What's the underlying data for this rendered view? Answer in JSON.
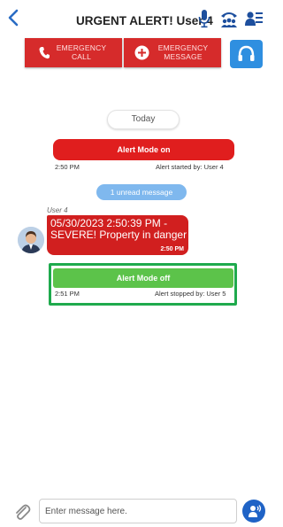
{
  "header": {
    "title": "URGENT ALERT! User 4",
    "icons": [
      "back-arrow-icon",
      "microphone-icon",
      "group-call-icon",
      "participants-icon"
    ]
  },
  "actions": {
    "emergency_call": {
      "line1": "EMERGENCY",
      "line2": "CALL",
      "icon": "phone-icon"
    },
    "emergency_message": {
      "line1": "EMERGENCY",
      "line2": "MESSAGE",
      "icon": "add-message-icon"
    },
    "headset_icon": "headset-icon"
  },
  "chat": {
    "date_divider": "Today",
    "alert_on": {
      "label": "Alert Mode on",
      "time": "2:50 PM",
      "status": "Alert started by: User 4"
    },
    "unread": "1 unread message",
    "message": {
      "sender": "User 4",
      "text": "05/30/2023 2:50:39 PM - SEVERE! Property in danger",
      "time": "2:50 PM"
    },
    "alert_off": {
      "label": "Alert Mode off",
      "time": "2:51 PM",
      "status": "Alert stopped by: User 5"
    }
  },
  "composer": {
    "placeholder": "Enter message here.",
    "attach_icon": "paperclip-icon",
    "voice_icon": "voice-assistant-icon"
  },
  "colors": {
    "alert_red": "#e01e1e",
    "alert_green": "#5cc34a",
    "highlight_green": "#1faa4d",
    "accent_blue": "#2f8fe0"
  }
}
